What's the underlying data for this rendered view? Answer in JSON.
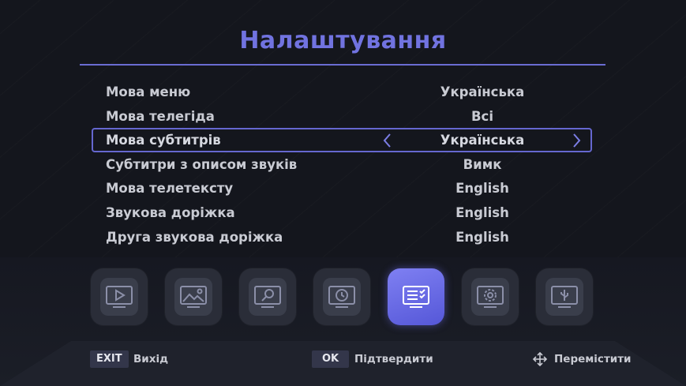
{
  "title": "Налаштування",
  "rows": [
    {
      "label": "Мова меню",
      "value": "Українська"
    },
    {
      "label": "Мова телегіда",
      "value": "Всі"
    },
    {
      "label": "Мова субтитрів",
      "value": "Українська"
    },
    {
      "label": "Субтитри з описом звуків",
      "value": "Вимк"
    },
    {
      "label": "Мова телетексту",
      "value": "English"
    },
    {
      "label": "Звукова доріжка",
      "value": "English"
    },
    {
      "label": "Друга звукова доріжка",
      "value": "English"
    }
  ],
  "selected_row_index": 2,
  "icons": [
    "media-player-icon",
    "image-gallery-icon",
    "search-icon",
    "clock-icon",
    "language-settings-icon",
    "gear-settings-icon",
    "usb-icon"
  ],
  "active_icon_index": 4,
  "footer": {
    "exit_key": "EXIT",
    "exit_label": "Вихід",
    "ok_key": "OK",
    "ok_label": "Підтвердити",
    "move_label": "Перемістити"
  },
  "colors": {
    "accent": "#6a6cd2",
    "background": "#14161d"
  }
}
